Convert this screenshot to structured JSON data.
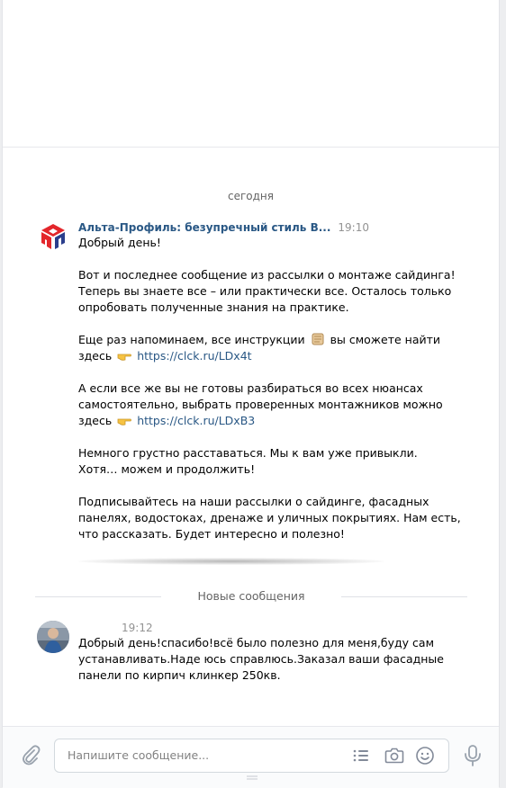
{
  "dialog": {
    "date_separator": "сегодня",
    "new_messages_separator": "Новые сообщения"
  },
  "messages": [
    {
      "author": "Альта-Профиль: безупречный стиль В...",
      "time": "19:10",
      "avatar_icon": "alta-profil-logo",
      "paragraphs": [
        {
          "lines": [
            "Добрый день!"
          ]
        },
        {
          "lines": [
            "Вот и последнее сообщение из рассылки о монтаже сайдинга!",
            "Теперь вы знаете все – или практически все. Осталось только",
            "опробовать полученные знания на практике."
          ]
        },
        {
          "line1_before": "Еще раз напоминаем, все инструкции",
          "line1_after": "вы сможете найти",
          "line2_before": "здесь",
          "link": "https://clck.ru/LDx4t"
        },
        {
          "lines": [
            "А если все же вы не готовы разбираться во всех нюансах",
            "самостоятельно, выбрать проверенных монтажников можно"
          ],
          "last_before": "здесь",
          "link": "https://clck.ru/LDxB3"
        },
        {
          "lines": [
            "Немного грустно расставаться. Мы к вам уже привыкли.",
            "Хотя… можем и продолжить!"
          ]
        },
        {
          "lines": [
            "Подписывайтесь на наши рассылки о сайдинге, фасадных",
            "панелях, водостоках, дренаже и уличных покрытиях. Нам есть,",
            "что рассказать. Будет интересно и полезно!"
          ]
        }
      ]
    },
    {
      "author": "",
      "time": "19:12",
      "avatar_icon": "user-photo",
      "lines": [
        "Добрый день!спасибо!всё было полезно для меня,буду сам",
        "устанавливать.Наде юсь справлюсь.Заказал ваши фасадные",
        "панели по кирпич клинкер 250кв."
      ]
    }
  ],
  "composer": {
    "placeholder": "Напишите сообщение...",
    "icons": [
      "paperclip-icon",
      "templates-list-icon",
      "camera-icon",
      "emoji-icon",
      "microphone-icon"
    ]
  },
  "colors": {
    "link": "#2a5885",
    "author": "#2a5885",
    "brand_red": "#e3262b",
    "brand_blue": "#2b3e8c"
  }
}
